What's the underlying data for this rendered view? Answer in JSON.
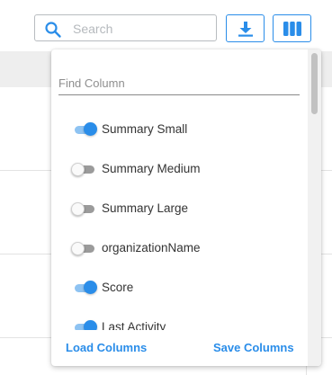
{
  "toolbar": {
    "search_placeholder": "Search",
    "search_value": "",
    "accent_color": "#2a8de9"
  },
  "column_panel": {
    "find_placeholder": "Find Column",
    "find_value": "",
    "columns": [
      {
        "label": "Summary Small",
        "enabled": true
      },
      {
        "label": "Summary Medium",
        "enabled": false
      },
      {
        "label": "Summary Large",
        "enabled": false
      },
      {
        "label": "organizationName",
        "enabled": false
      },
      {
        "label": "Score",
        "enabled": true
      },
      {
        "label": "Last Activity",
        "enabled": true
      }
    ],
    "load_label": "Load Columns",
    "save_label": "Save Columns"
  }
}
